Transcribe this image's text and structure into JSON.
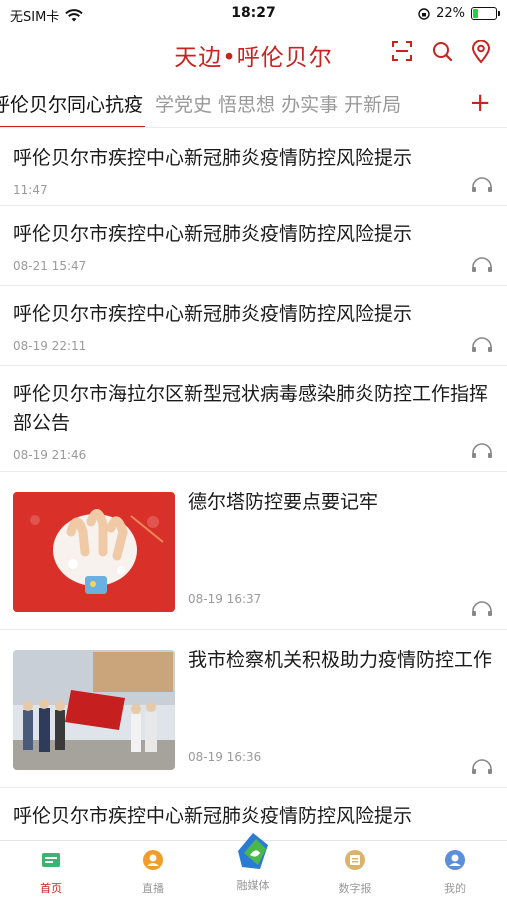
{
  "status_bar": {
    "carrier": "无SIM卡",
    "time": "18:27",
    "battery": "22%",
    "battery_level": 0.22
  },
  "header": {
    "title": "天边•呼伦贝尔",
    "icons": [
      "scan-icon",
      "search-icon",
      "location-icon"
    ]
  },
  "tabs": {
    "items": [
      "呼伦贝尔同心抗疫",
      "学党史 悟思想 办实事 开新局"
    ],
    "active": 0,
    "add_label": "+"
  },
  "news": [
    {
      "title": "呼伦贝尔市疾控中心新冠肺炎疫情防控风险提示",
      "time": "11:47"
    },
    {
      "title": "呼伦贝尔市疾控中心新冠肺炎疫情防控风险提示",
      "time": "08-21 15:47"
    },
    {
      "title": "呼伦贝尔市疾控中心新冠肺炎疫情防控风险提示",
      "time": "08-19 22:11"
    },
    {
      "title": "呼伦贝尔市海拉尔区新型冠状病毒感染肺炎防控工作指挥部公告",
      "time": "08-19 21:46"
    },
    {
      "title": "德尔塔防控要点要记牢",
      "time": "08-19 16:37"
    },
    {
      "title": "我市检察机关积极助力疫情防控工作",
      "time": "08-19 16:36"
    },
    {
      "title": "呼伦贝尔市疾控中心新冠肺炎疫情防控风险提示",
      "time": ""
    }
  ],
  "tabbar": [
    {
      "label": "首页"
    },
    {
      "label": "直播"
    },
    {
      "label": "融媒体"
    },
    {
      "label": "数字报"
    },
    {
      "label": "我的"
    }
  ],
  "colors": {
    "brand": "#c8241f",
    "muted": "#9a9a9a",
    "divider": "#ececec"
  }
}
